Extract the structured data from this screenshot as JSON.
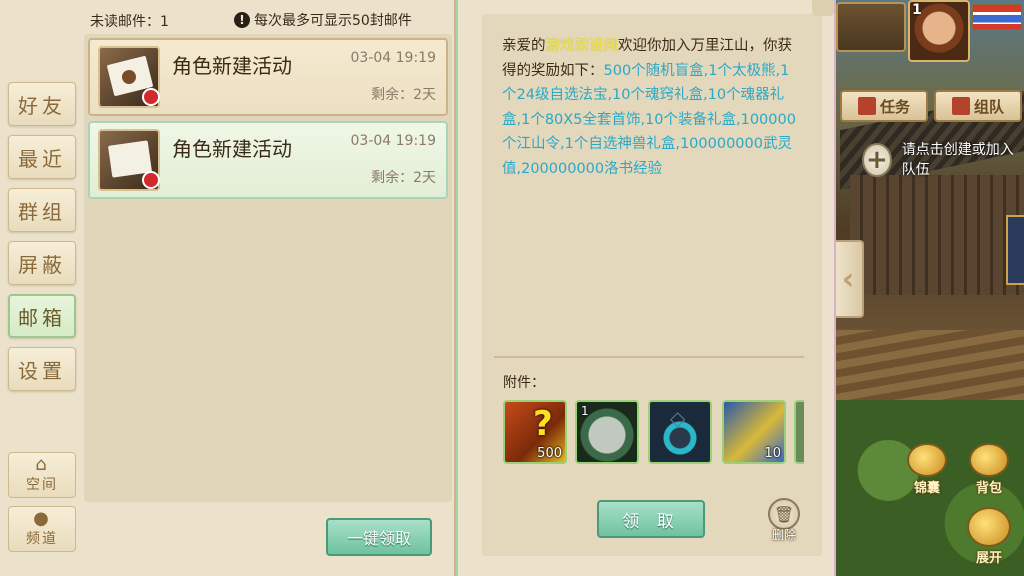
{
  "nav": {
    "items": [
      {
        "label": "好友",
        "active": false
      },
      {
        "label": "最近",
        "active": false
      },
      {
        "label": "群组",
        "active": false
      },
      {
        "label": "屏蔽",
        "active": false
      },
      {
        "label": "邮箱",
        "active": true
      },
      {
        "label": "设置",
        "active": false
      }
    ],
    "space_label": "空间",
    "channel_label": "频道"
  },
  "mailbox": {
    "unread_label": "未读邮件：",
    "unread_count": "1",
    "max_note": "每次最多可显示50封邮件",
    "mails": [
      {
        "title": "角色新建活动",
        "date": "03-04 19:19",
        "remaining": "剩余：2天"
      },
      {
        "title": "角色新建活动",
        "date": "03-04 19:19",
        "remaining": "剩余：2天"
      }
    ],
    "claim_all_label": "一键领取"
  },
  "mail_detail": {
    "greeting_prefix": "亲爱的",
    "player_name": "游戏架设网",
    "greeting_suffix": "欢迎你加入万里江山，你获得的奖励如下：",
    "rewards": "500个随机盲盒,1个太极熊,1个24级自选法宝,10个魂窍礼盒,10个魂器礼盒,1个80X5全套首饰,10个装备礼盒,100000个江山令,1个自选神兽礼盒,100000000武灵值,200000000洛书经验",
    "attachments_label": "附件：",
    "attachments": [
      {
        "icon": "mystery-box-icon",
        "count": "500",
        "level": ""
      },
      {
        "icon": "panda-mount-icon",
        "count": "",
        "level": "1"
      },
      {
        "icon": "bead-necklace-icon",
        "count": "",
        "level": ""
      },
      {
        "icon": "treasure-chest-icon",
        "count": "10",
        "level": ""
      }
    ],
    "claim_label": "领 取",
    "delete_label": "删除"
  },
  "hud": {
    "player_level": "1",
    "quest_tab": "任务",
    "team_tab": "组队",
    "team_hint": "请点击创建或加入队伍",
    "bottom_icons": [
      "锦囊",
      "背包",
      "展开"
    ]
  },
  "colors": {
    "panel_bg": "#ece2cc",
    "highlight_name": "#f2e64a",
    "reward_text": "#2aa8c8",
    "button_green": "#6fc2a0"
  }
}
